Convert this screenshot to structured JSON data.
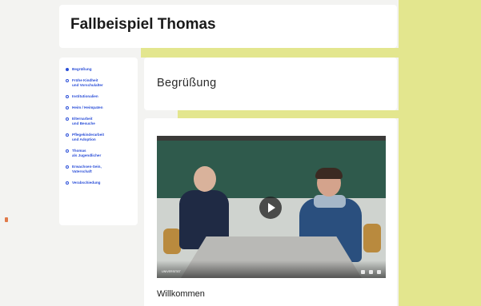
{
  "header": {
    "title": "Fallbeispiel Thomas"
  },
  "sidebar": {
    "items": [
      {
        "label": "Begrüßung",
        "active": true
      },
      {
        "label": "Frühe Kindheit\nund Vorschulalter",
        "active": false
      },
      {
        "label": "Institutionalien",
        "active": false
      },
      {
        "label": "Heim / Heimpaten",
        "active": false
      },
      {
        "label": "Elternarbeit\nund Besuche",
        "active": false
      },
      {
        "label": "Pflegekinderarbeit\nund Adoption",
        "active": false
      },
      {
        "label": "Thomas\nals Jugendlicher",
        "active": false
      },
      {
        "label": "Erwachsen-Sein,\nVaterschaft",
        "active": false
      },
      {
        "label": "Verabschiedung",
        "active": false
      }
    ]
  },
  "section": {
    "title": "Begrüßung"
  },
  "video": {
    "logo_text": "UNIVERSITÄT",
    "play_icon": "play-icon",
    "title": "Willkommen"
  },
  "colors": {
    "accent": "#e3e68e",
    "link": "#2b4fd8"
  }
}
